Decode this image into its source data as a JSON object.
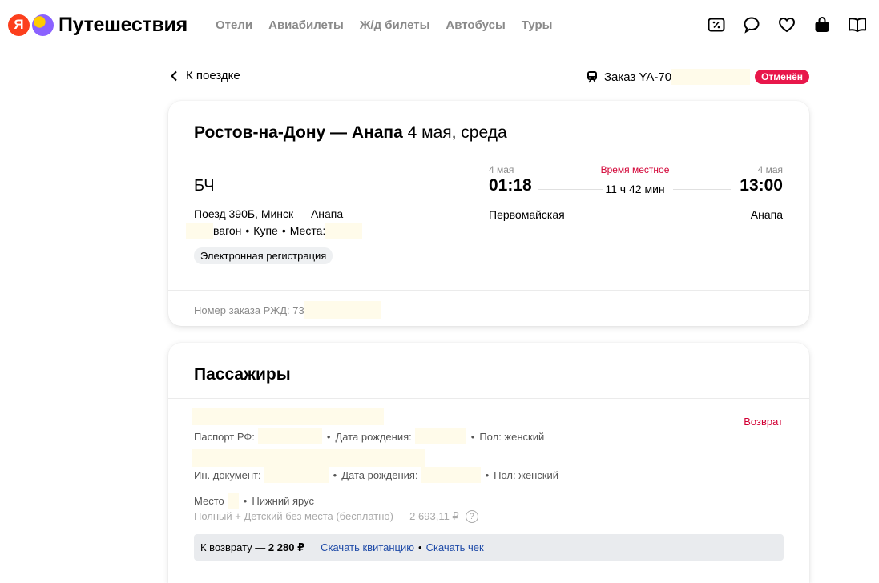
{
  "header": {
    "logo_letter": "Я",
    "title": "Путешествия",
    "nav": [
      "Отели",
      "Авиабилеты",
      "Ж/д билеты",
      "Автобусы",
      "Туры"
    ],
    "icons": [
      "discount-icon",
      "chat-icon",
      "heart-icon",
      "bag-icon",
      "book-icon"
    ]
  },
  "subheader": {
    "back_label": "К поездке",
    "order_label": "Заказ YA-70",
    "status": "Отменён"
  },
  "trip": {
    "route": "Ростов-на-Дону — Анапа",
    "date": "4 мая, среда",
    "carrier": "БЧ",
    "train": "Поезд 390Б, Минск — Анапа",
    "car_label": "вагон",
    "car_type": "Купе",
    "seats_label": "Места:",
    "chip": "Электронная регистрация",
    "departure": {
      "date": "4 мая",
      "time": "01:18",
      "station": "Первомайская"
    },
    "local_time_label": "Время местное",
    "duration": "11 ч 42 мин",
    "arrival": {
      "date": "4 мая",
      "time": "13:00",
      "station": "Анапа"
    },
    "rzd_label": "Номер заказа РЖД: 73"
  },
  "passengers": {
    "title": "Пассажиры",
    "refund_label": "Возврат",
    "p1": {
      "doc": "Паспорт РФ:",
      "birth": "Дата рождения:",
      "sex": "Пол: женский"
    },
    "p2": {
      "doc": "Ин. документ:",
      "birth": "Дата рождения:",
      "sex": "Пол: женский"
    },
    "seat_label": "Место",
    "tier": "Нижний ярус",
    "price": "Полный + Детский без места (бесплатно) — 2 693,11 ₽",
    "refund_prefix": "К возврату —",
    "refund_amount": "2 280 ₽",
    "receipt_link": "Скачать квитанцию",
    "check_link": "Скачать чек"
  },
  "colors": {
    "accent_red": "#e8174b",
    "link_blue": "#1f4ba8",
    "mask": "#fffbea"
  }
}
